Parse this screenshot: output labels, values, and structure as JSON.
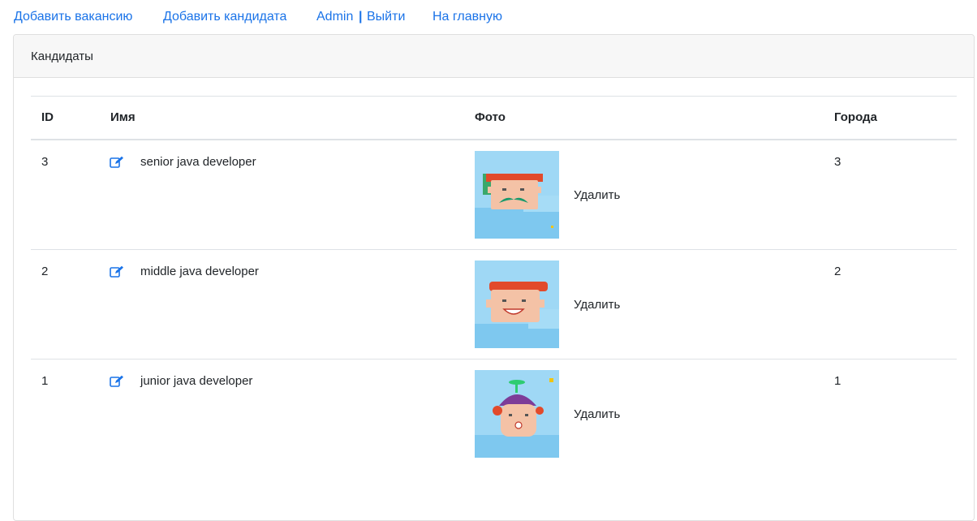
{
  "nav": {
    "add_vacancy": "Добавить вакансию",
    "add_candidate": "Добавить кандидата",
    "user": "Admin",
    "separator": "|",
    "logout": "Выйти",
    "home": "На главную"
  },
  "card": {
    "title": "Кандидаты"
  },
  "table": {
    "headers": {
      "id": "ID",
      "name": "Имя",
      "photo": "Фото",
      "city": "Города"
    },
    "rows": [
      {
        "id": "3",
        "name": "senior java developer",
        "delete": "Удалить",
        "city": "3",
        "avatar": "red-hair-mustache"
      },
      {
        "id": "2",
        "name": "middle java developer",
        "delete": "Удалить",
        "city": "2",
        "avatar": "red-hair-smile"
      },
      {
        "id": "1",
        "name": "junior java developer",
        "delete": "Удалить",
        "city": "1",
        "avatar": "propeller-cap-kid"
      }
    ]
  },
  "colors": {
    "link": "#1a73e8",
    "header_bg": "#f7f7f7",
    "border": "#dee2e6",
    "photo_bg": "#7ec8ef"
  },
  "icons": {
    "edit": "edit-icon"
  }
}
